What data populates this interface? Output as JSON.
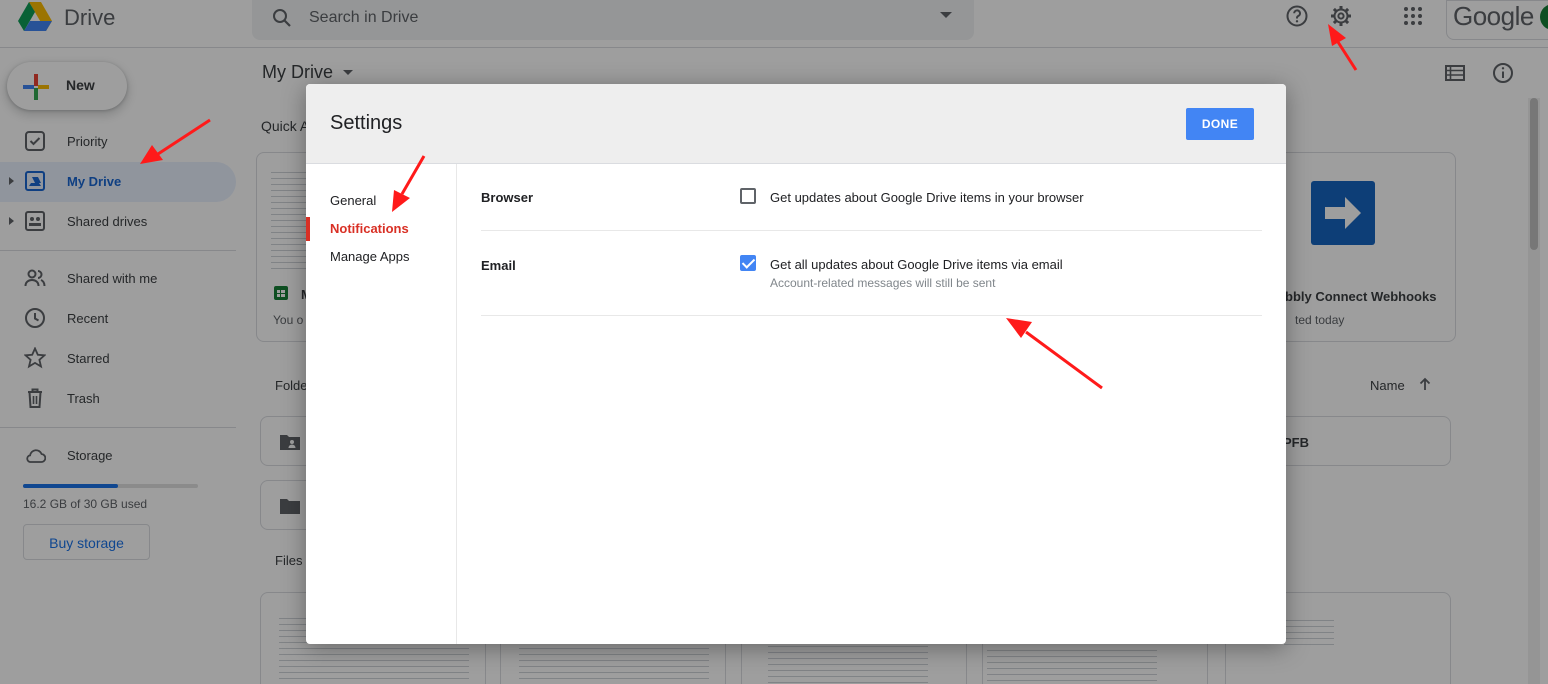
{
  "app": {
    "brand": "Drive",
    "search_placeholder": "Search in Drive",
    "google_word": "Google"
  },
  "sidebar": {
    "new_label": "New",
    "items": [
      {
        "label": "Priority"
      },
      {
        "label": "My Drive"
      },
      {
        "label": "Shared drives"
      },
      {
        "label": "Shared with me"
      },
      {
        "label": "Recent"
      },
      {
        "label": "Starred"
      },
      {
        "label": "Trash"
      },
      {
        "label": "Storage"
      }
    ],
    "storage_used_fraction": 0.54,
    "storage_text": "16.2 GB of 30 GB used",
    "buy_storage": "Buy storage"
  },
  "main": {
    "title": "My Drive",
    "quick_access_partial": "Quick A",
    "card_left_title_partial": "M",
    "card_left_sub_partial": "You o",
    "card_right_title_partial": "bbly Connect Webhooks",
    "card_right_sub_partial": "ted today",
    "folders_partial": "Folde",
    "sort_label": "Name",
    "folder_right_partial": "PFB",
    "files_label": "Files"
  },
  "settings": {
    "title": "Settings",
    "done_label": "DONE",
    "nav": [
      {
        "label": "General"
      },
      {
        "label": "Notifications"
      },
      {
        "label": "Manage Apps"
      }
    ],
    "browser": {
      "label": "Browser",
      "option": "Get updates about Google Drive items in your browser",
      "checked": false
    },
    "email": {
      "label": "Email",
      "option": "Get all updates about Google Drive items via email",
      "sub": "Account-related messages will still be sent",
      "checked": true
    }
  },
  "colors": {
    "accent_blue": "#4285f4",
    "active_red": "#d93025",
    "annotation_red": "#ff1a1a"
  }
}
